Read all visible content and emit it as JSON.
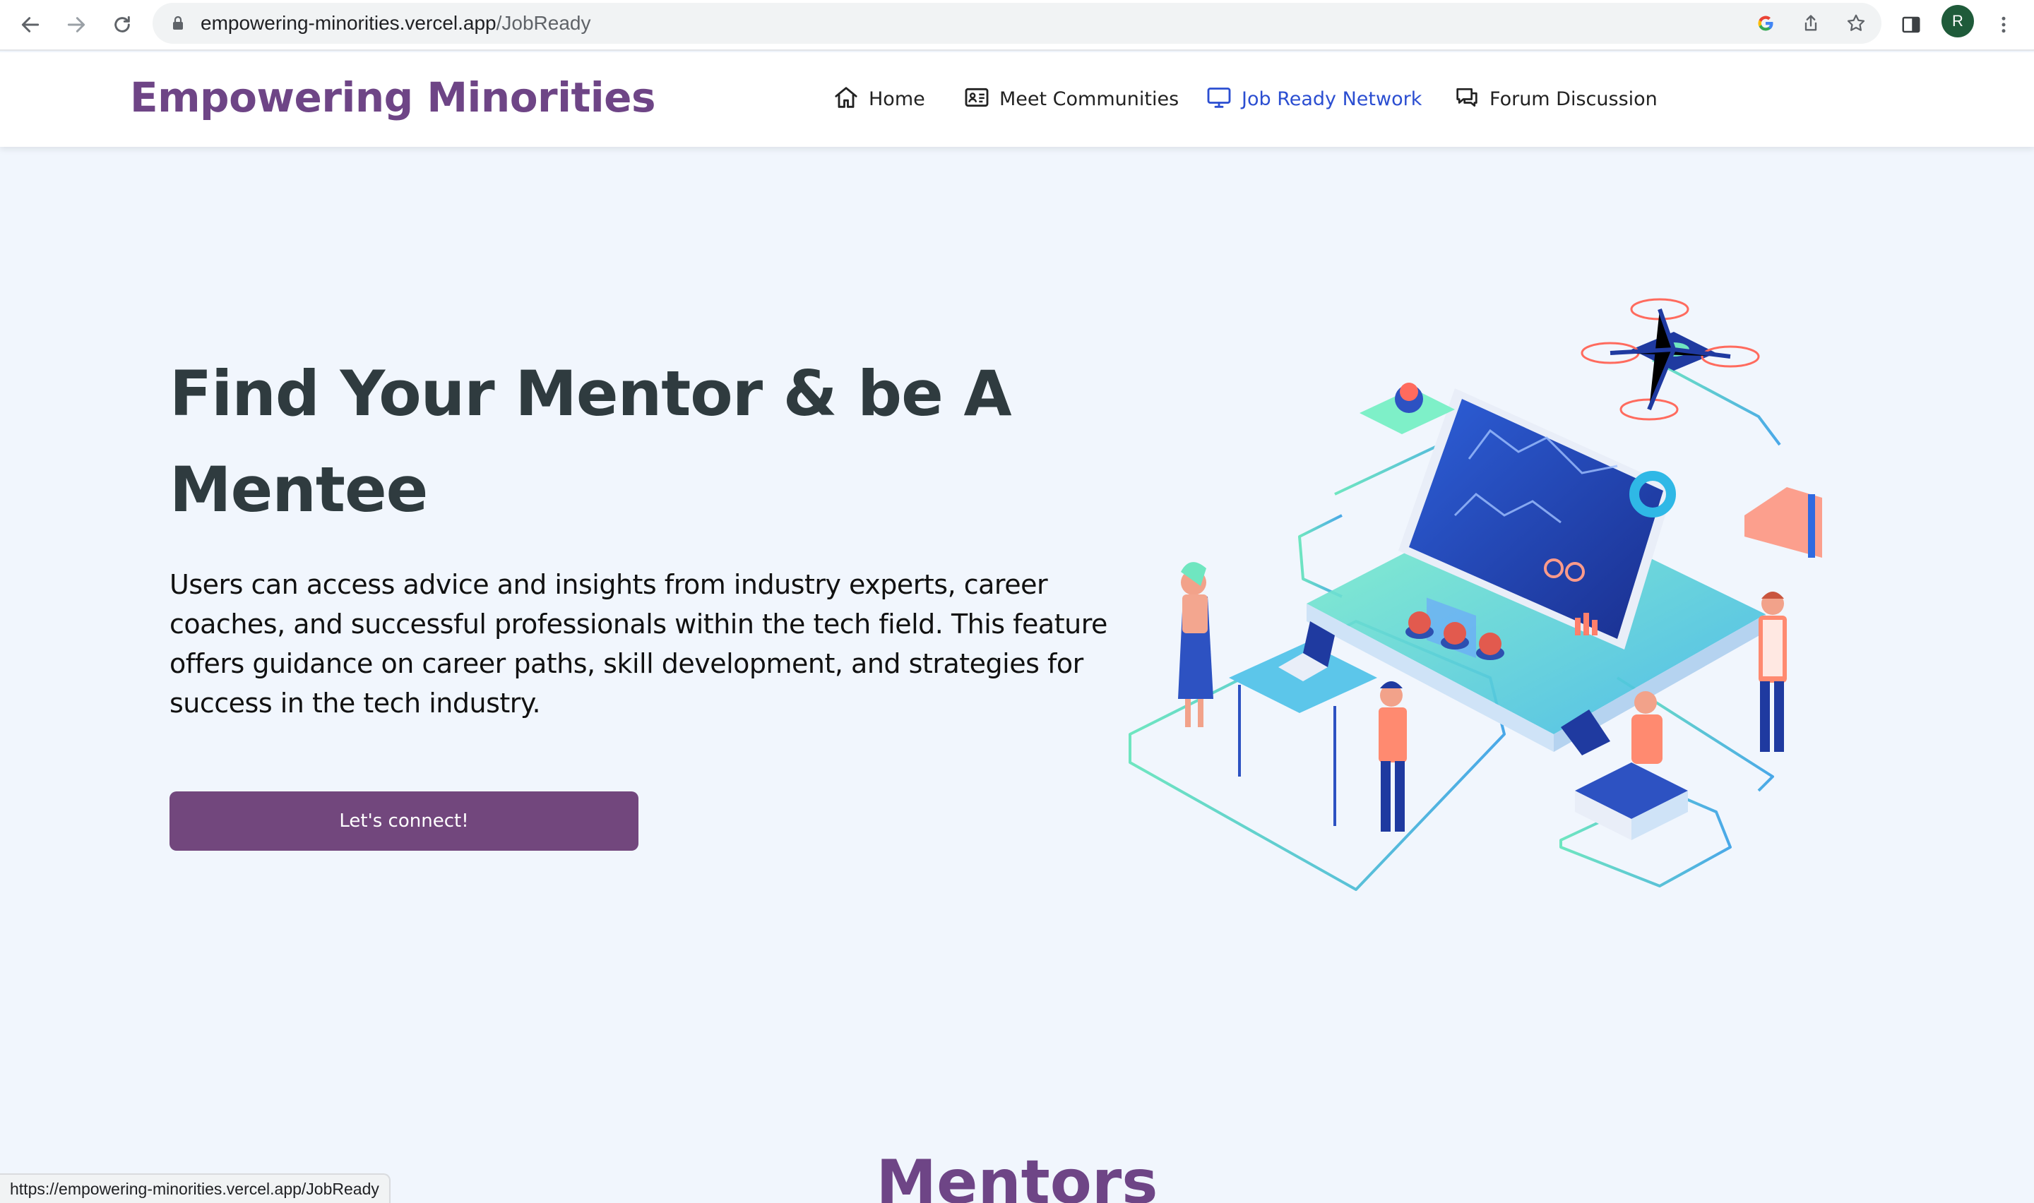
{
  "browser": {
    "url_host": "empowering-minorities.vercel.app",
    "url_path": "/JobReady",
    "profile_initial": "R",
    "status_url": "https://empowering-minorities.vercel.app/JobReady"
  },
  "site": {
    "brand": "Empowering Minorities",
    "nav": [
      {
        "label": "Home",
        "icon": "home-icon"
      },
      {
        "label": "Meet Communities",
        "icon": "id-card-icon"
      },
      {
        "label": "Job Ready Network",
        "icon": "monitor-icon",
        "active": true
      },
      {
        "label": "Forum Discussion",
        "icon": "chat-bubbles-icon"
      }
    ]
  },
  "hero": {
    "title": "Find Your Mentor & be A Mentee",
    "description": "Users can access advice and insights from industry experts, career coaches, and successful professionals within the tech field. This feature offers guidance on career paths, skill development, and strategies for success in the tech industry.",
    "cta_label": "Let's connect!"
  },
  "mentors": {
    "title": "Mentors"
  },
  "colors": {
    "brand": "#6e4586",
    "cta": "#72477d",
    "active_nav": "#2b4ed1",
    "page_bg": "#f1f6fd"
  }
}
